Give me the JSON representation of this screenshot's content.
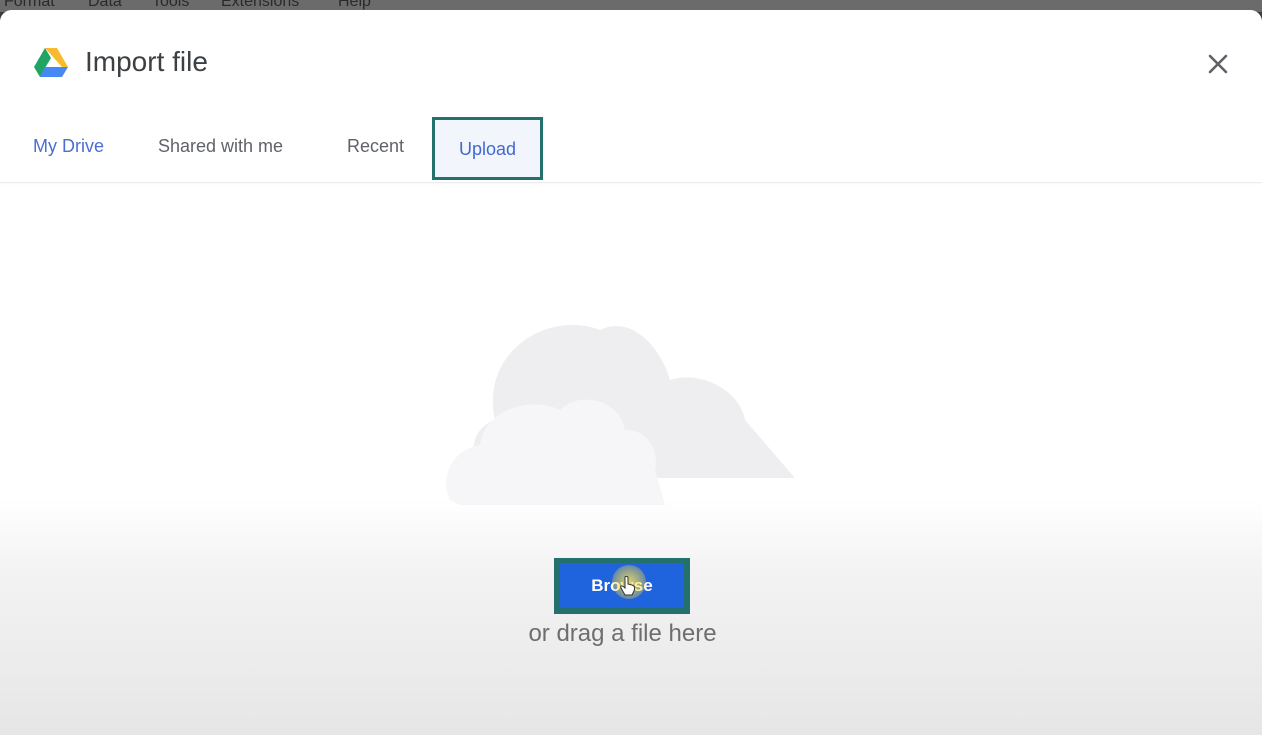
{
  "menubar": {
    "items": [
      "Format",
      "Data",
      "Tools",
      "Extensions",
      "Help"
    ]
  },
  "dialog": {
    "title": "Import file",
    "logo_icon": "google-drive-icon",
    "close_icon": "close-icon"
  },
  "tabs": [
    {
      "label": "My Drive",
      "selected": false
    },
    {
      "label": "Shared with me",
      "selected": false
    },
    {
      "label": "Recent",
      "selected": false
    },
    {
      "label": "Upload",
      "selected": true
    }
  ],
  "upload": {
    "illustration_icon": "cloud-icon",
    "browse_label": "Browse",
    "drag_text": "or drag a file here"
  },
  "colors": {
    "accent": "#1f64dc",
    "highlight_box": "#23706c",
    "active_tab_text": "#3f6ad0"
  }
}
